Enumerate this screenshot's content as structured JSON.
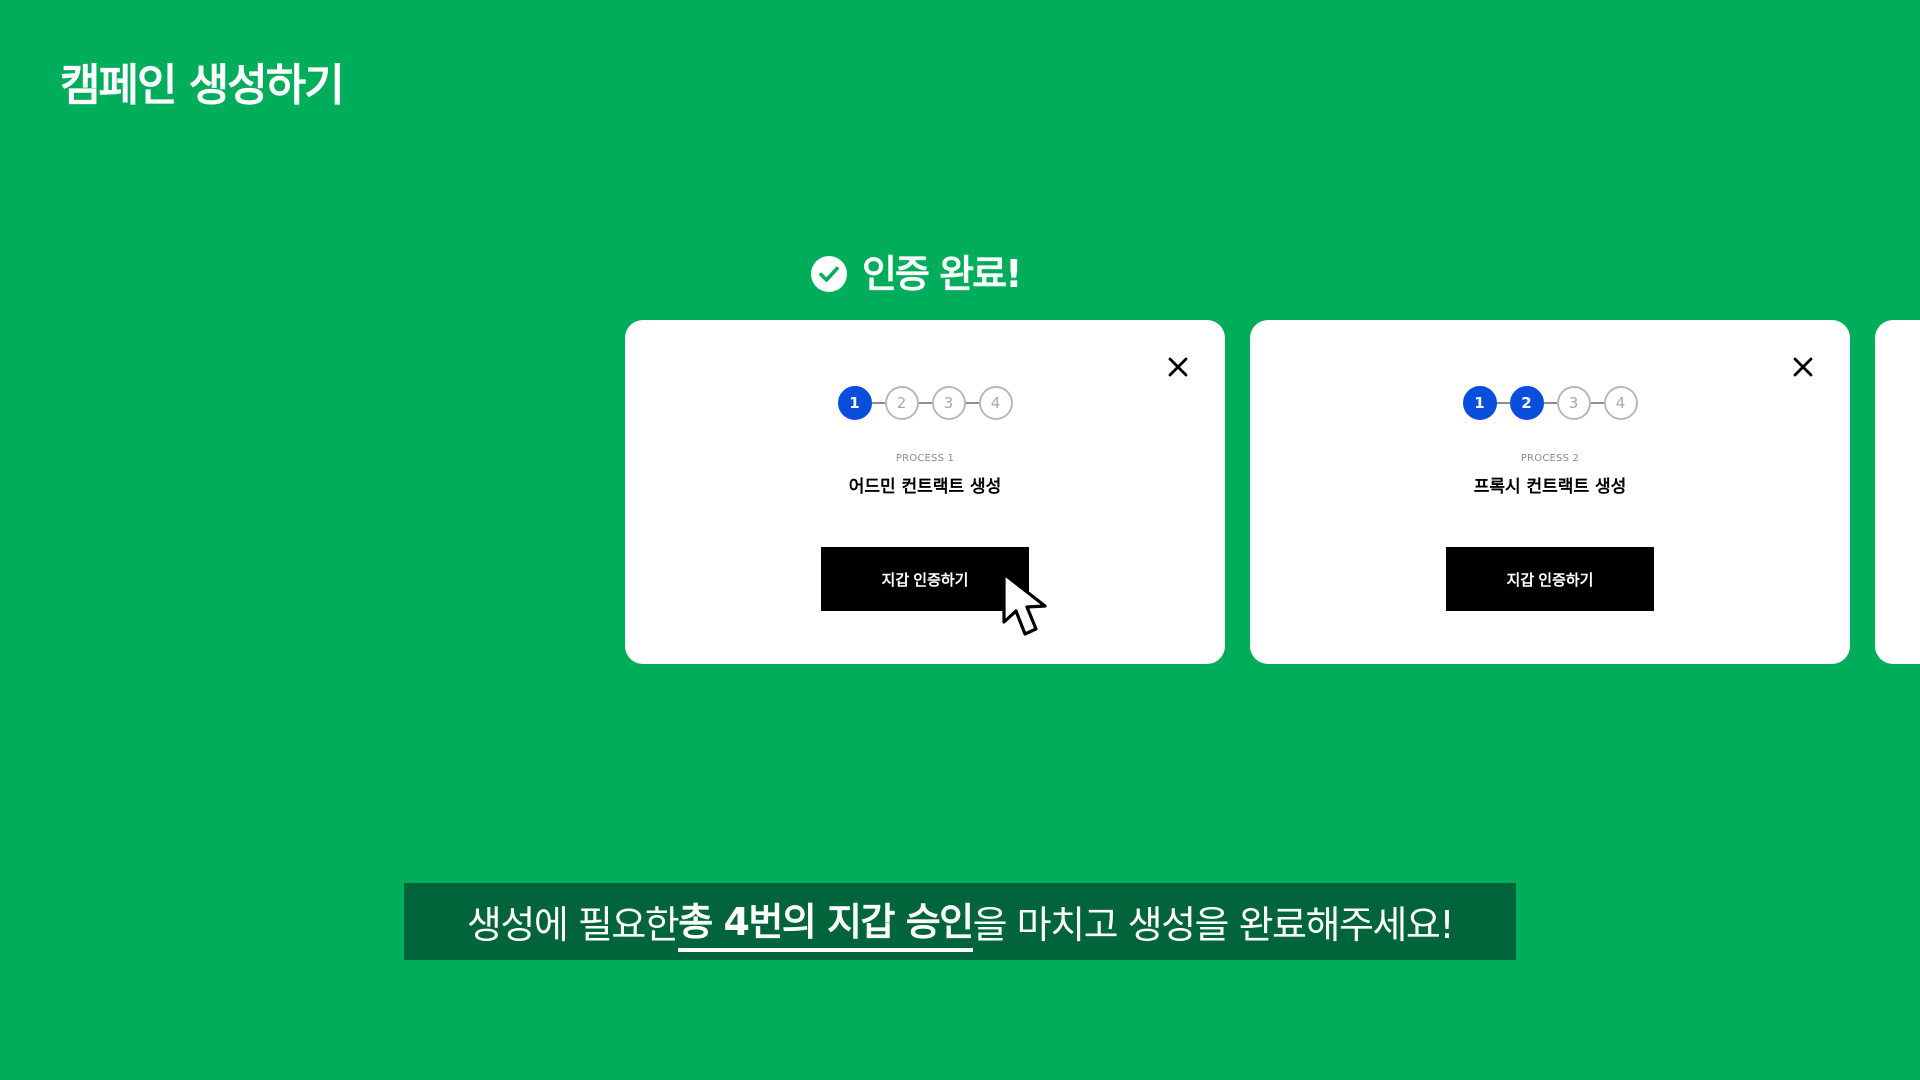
{
  "page": {
    "title": "캠페인 생성하기"
  },
  "auth": {
    "status_text": "인증 완료!",
    "icon": "check-circle-icon"
  },
  "cards": [
    {
      "steps": [
        "1",
        "2",
        "3",
        "4"
      ],
      "active_steps": 1,
      "process_label": "PROCESS 1",
      "process_name": "어드민 컨트랙트 생성",
      "button_label": "지갑 인증하기",
      "close_icon": "close-icon"
    },
    {
      "steps": [
        "1",
        "2",
        "3",
        "4"
      ],
      "active_steps": 2,
      "process_label": "PROCESS 2",
      "process_name": "프록시 컨트랙트 생성",
      "button_label": "지갑 인증하기",
      "close_icon": "close-icon"
    }
  ],
  "caption": {
    "prefix": "생성에 필요한 ",
    "emphasis": "총 4번의 지갑 승인",
    "suffix": "을 마치고 생성을 완료해주세요!"
  },
  "colors": {
    "background": "#00ad5b",
    "caption_background": "#01643a",
    "step_active": "#0a4fdc",
    "button": "#000000"
  },
  "pointer": {
    "icon": "mouse-pointer-icon"
  }
}
